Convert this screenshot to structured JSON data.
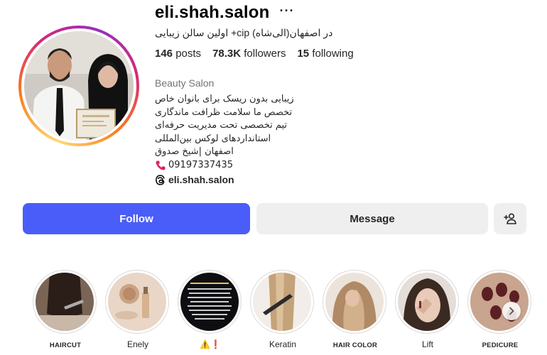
{
  "profile": {
    "username": "eli.shah.salon",
    "full_name": "اولین سالن زیبایی +cip در اصفهان(الی‌شاه)",
    "stats": {
      "posts_count": "146",
      "posts_label": "posts",
      "followers_count": "78.3K",
      "followers_label": "followers",
      "following_count": "15",
      "following_label": "following"
    },
    "category": "Beauty Salon",
    "bio_lines": [
      "زیبایی بدون ریسک برای بانوان خاص",
      "تخصص ما سلامت ظرافت ماندگاری",
      "تیم تخصصی تحت مدیریت حرفه‌ای",
      "استانداردهای لوکس بین‌المللی",
      "اصفهان |شیخ صدوق"
    ],
    "phone": "09197337435",
    "threads_handle": "eli.shah.salon"
  },
  "actions": {
    "follow_label": "Follow",
    "message_label": "Message"
  },
  "highlights": [
    {
      "label": "HAIRCUT"
    },
    {
      "label": "Enely"
    },
    {
      "label": "⚠️❗"
    },
    {
      "label": "Keratin"
    },
    {
      "label": "HAIR COLOR"
    },
    {
      "label": "Lift"
    },
    {
      "label": "PEDICURE"
    }
  ],
  "icons": {
    "more": "more-options-icon",
    "phone": "phone-icon",
    "threads": "threads-icon",
    "add_person": "add-person-icon",
    "next": "chevron-right-icon"
  },
  "colors": {
    "follow_button": "#4a5df9",
    "secondary_button": "#efefef",
    "text_primary": "#262626",
    "text_muted": "#737373"
  }
}
